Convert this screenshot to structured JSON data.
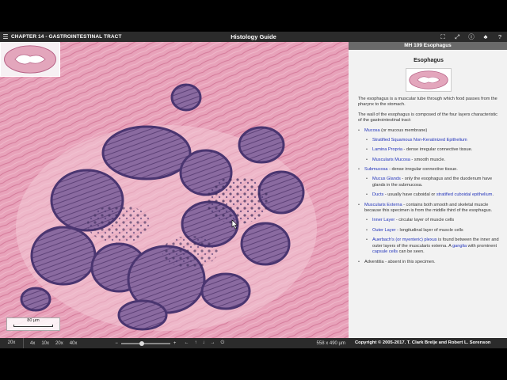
{
  "topbar": {
    "chapter": "CHAPTER 14 - GASTROINTESTINAL TRACT",
    "title": "Histology Guide",
    "icons": [
      "fullscreen-icon",
      "expand-icon",
      "info-icon",
      "notification-icon",
      "help-icon"
    ]
  },
  "viewer": {
    "scale_label": "80 µm"
  },
  "bottombar": {
    "current_zoom": "20x",
    "zoom_levels": [
      "4x",
      "10x",
      "20x",
      "40x"
    ],
    "zoom_out": "−",
    "zoom_in": "+",
    "nav": [
      "←",
      "↑",
      "↓",
      "→",
      "⏻"
    ],
    "dimensions": "558 x 490 µm"
  },
  "panel": {
    "header": "MH 109 Esophagus",
    "title": "Esophagus",
    "intro1": "The esophagus is a muscular tube through which food passes from the pharynx to the stomach.",
    "intro2": "The wall of the esophagus is composed of the four layers characteristic of the gastrointestinal tract:",
    "mucosa_link": "Mucosa",
    "mucosa_rest": " (or mucous membrane)",
    "epi_link": "Stratified Squamous Non-Keratinized Epithelium",
    "lp_link": "Lamina Propria",
    "lp_rest": " - dense irregular connective tissue.",
    "mm_link": "Muscularis Mucosa",
    "mm_rest": " - smooth muscle.",
    "sub_link": "Submucosa",
    "sub_rest": " - dense irregular connective tissue.",
    "glands_link": "Mucus Glands",
    "glands_rest": " - only the esophagus and the duodenum have glands in the submucosa.",
    "ducts_link": "Ducts",
    "ducts_rest": " - usually have cuboidal or ",
    "ducts_link2": "stratified cuboidal epithelium",
    "ducts_end": ".",
    "me_link": "Muscularis Externa",
    "me_rest": " - contains both smooth and skeletal muscle because this specimen is from the middle third of the esophagus.",
    "inner_link": "Inner Layer",
    "inner_rest": " - circular layer of muscle cells",
    "outer_link": "Outer Layer",
    "outer_rest": " - longitudinal layer of muscle cells",
    "aue_link": "Auerbach's (or myenteric) plexus",
    "aue_rest": " is found between the inner and outer layers of the muscularis externa. A ",
    "ganglia_link": "ganglia",
    "aue_rest2": " with prominent ",
    "capsule_link": "capsule cells",
    "aue_end": " can be seen.",
    "adventitia": "Adventitia - absent in this specimen."
  },
  "footer": {
    "copyright": "Copyright © 2005-2017. T. Clark Brelje and Robert L. Sorenson"
  },
  "colors": {
    "tissue_pink": "#e7a3b9",
    "gland_purple": "#7b5a92",
    "nucleus": "#3a2a5a",
    "link": "#2233bb"
  }
}
